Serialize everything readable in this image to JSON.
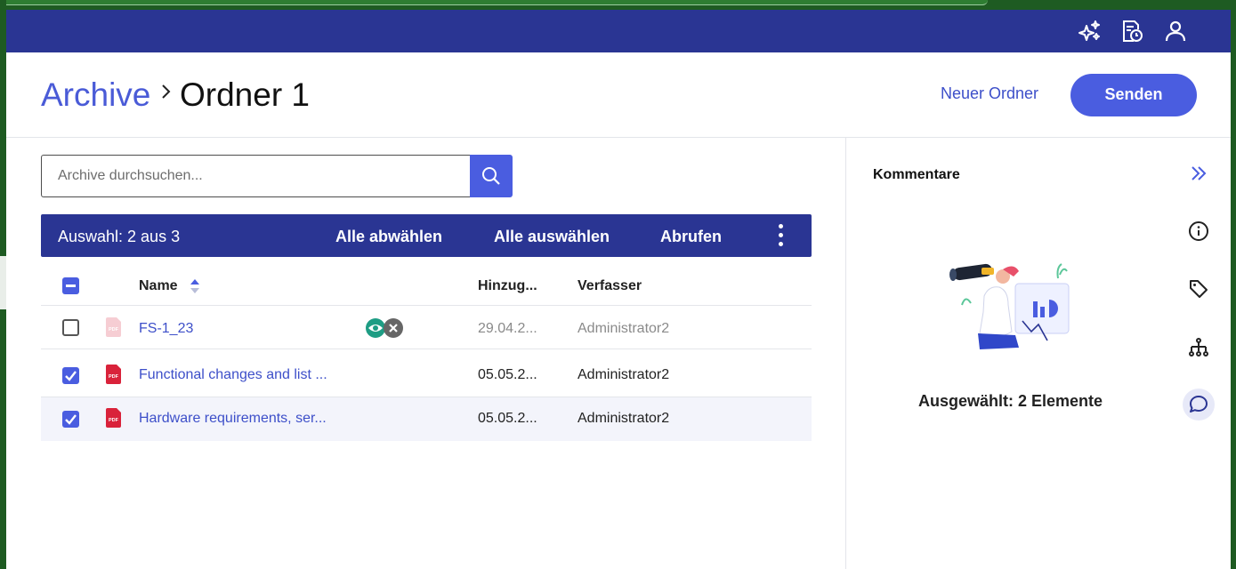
{
  "breadcrumb": {
    "root": "Archive",
    "current": "Ordner 1"
  },
  "header": {
    "new_folder_label": "Neuer Ordner",
    "send_label": "Senden"
  },
  "topbar_icons": [
    "sparkles-icon",
    "document-clock-icon",
    "user-icon"
  ],
  "search": {
    "placeholder": "Archive durchsuchen..."
  },
  "selection_bar": {
    "text": "Auswahl: 2 aus 3",
    "deselect_all": "Alle abwählen",
    "select_all": "Alle auswählen",
    "retrieve": "Abrufen"
  },
  "table": {
    "columns": {
      "name": "Name",
      "added": "Hinzug...",
      "author": "Verfasser"
    },
    "rows": [
      {
        "checked": false,
        "name": "FS-1_23",
        "added": "29.04.2...",
        "author": "Administrator2",
        "status": [
          "eye-icon",
          "close-icon"
        ]
      },
      {
        "checked": true,
        "name": "Functional changes and list ...",
        "added": "05.05.2...",
        "author": "Administrator2"
      },
      {
        "checked": true,
        "name": "Hardware requirements, ser...",
        "added": "05.05.2...",
        "author": "Administrator2"
      }
    ]
  },
  "panel": {
    "title": "Kommentare",
    "caption": "Ausgewählt: 2 Elemente",
    "side_icons": [
      "collapse-double-chevron-icon",
      "info-icon",
      "tag-icon",
      "hierarchy-icon",
      "comment-icon"
    ]
  },
  "colors": {
    "primary": "#4a5de0",
    "navbar": "#2a3593",
    "link": "#3d4fc9"
  }
}
